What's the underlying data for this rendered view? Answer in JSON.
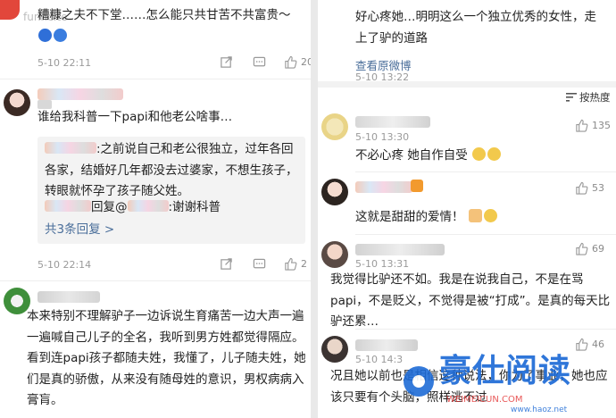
{
  "left": {
    "top_comment": {
      "text": "糟糠之夫不下堂……怎么能只共甘苦不共富贵～",
      "time": "5-10 22:11",
      "like_count": "20"
    },
    "watermark_left": "funnc.te",
    "comment2": {
      "text": "谁给我科普一下papi和他老公啥事…",
      "reply1": ":之前说自己和老公很独立，过年各回各家，结婚好几年都没去过婆家，不想生孩子，转眼就怀孕了孩子随父姓。",
      "reply2_prefix": "回复@",
      "reply2_suffix": ":谢谢科普",
      "more_replies": "共3条回复 >",
      "time": "5-10 22:14",
      "like_count": "2"
    },
    "comment3": {
      "text": "本来特别不理解驴子一边诉说生育痛苦一边大声一遍一遍喊自己儿子的全名，我听到男方姓都觉得隔应。看到连papi孩子都随夫姓，我懂了，儿子随夫姓，她们是真的骄傲，从来没有随母姓的意识，男权病病入膏肓。"
    }
  },
  "right": {
    "top": {
      "text": "好心疼她…明明这么一个独立优秀的女性，走上了驴的道路",
      "time": "5-10 13:22",
      "view_original": "查看原微博"
    },
    "sort_label": "按热度",
    "comments": [
      {
        "time": "5-10 13:30",
        "text": "不必心疼 她自作自受",
        "likes": "135"
      },
      {
        "time": "5-10 13:30",
        "text": "这就是甜甜的爱情！",
        "likes": "53"
      },
      {
        "time": "5-10 13:31",
        "text": "我觉得比驴还不如。我是在说我自己，不是在骂papi，不是贬义，不觉得是被“打成”。是真的每天比驴还累…",
        "likes": "69"
      },
      {
        "time": "5-10 14:3",
        "text": "况且她以前也是相信这种说法，你为了事业，她也应该只要有个头脑，照样逃不过",
        "likes": "46"
      }
    ],
    "watermark_brand": "豪仕阅读",
    "watermark_url": "www.haoz.net",
    "watermark_url2": "WEIMEICUN.COM"
  },
  "colors": {
    "link": "#4a6e9a",
    "meta": "#9a9a9a",
    "watermark": "#1e6bd6"
  }
}
